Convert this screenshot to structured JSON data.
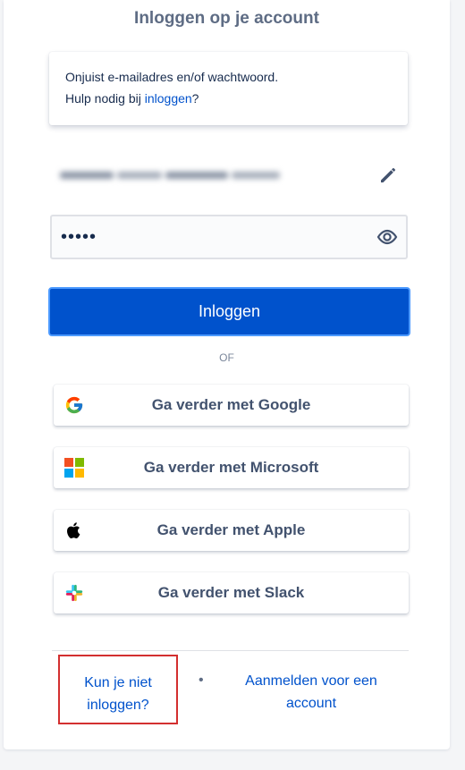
{
  "header": {
    "title": "Inloggen op je account"
  },
  "error": {
    "line1": "Onjuist e-mailadres en/of wachtwoord.",
    "line2_prefix": "Hulp nodig bij ",
    "line2_link": "inloggen",
    "line2_suffix": "?"
  },
  "email": {
    "value_redacted": "[redacted]",
    "edit_icon": "pencil-icon"
  },
  "password": {
    "value": "•••••",
    "toggle_icon": "eye-icon"
  },
  "login_button": {
    "label": "Inloggen"
  },
  "separator": {
    "label": "OF"
  },
  "sso": [
    {
      "label": "Ga verder met Google",
      "icon": "google-icon"
    },
    {
      "label": "Ga verder met Microsoft",
      "icon": "microsoft-icon"
    },
    {
      "label": "Ga verder met Apple",
      "icon": "apple-icon"
    },
    {
      "label": "Ga verder met Slack",
      "icon": "slack-icon"
    }
  ],
  "footer": {
    "cant_login_line1": "Kun je niet",
    "cant_login_line2": "inloggen?",
    "bullet": "•",
    "signup_line1": "Aanmelden voor een",
    "signup_line2": "account"
  },
  "colors": {
    "primary": "#0052cc",
    "focus_border": "#4c9aff",
    "highlight_box": "#d32f2f",
    "text": "#172b4d",
    "muted": "#5e6c84"
  }
}
